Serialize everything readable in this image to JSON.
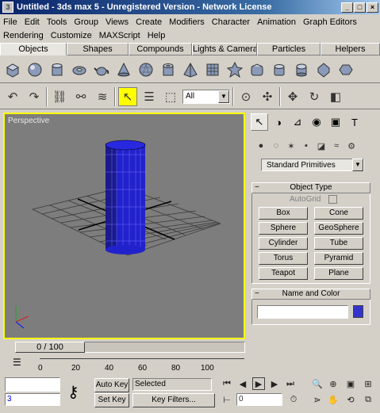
{
  "window": {
    "title": "Untitled - 3ds max 5 - Unregistered Version - Network License"
  },
  "menu": {
    "row1": [
      "File",
      "Edit",
      "Tools",
      "Group",
      "Views",
      "Create",
      "Modifiers",
      "Character",
      "Animation",
      "Graph Editors"
    ],
    "row2": [
      "Rendering",
      "Customize",
      "MAXScript",
      "Help"
    ]
  },
  "tabs": [
    "Objects",
    "Shapes",
    "Compounds",
    "Lights & Cameras",
    "Particles",
    "Helpers"
  ],
  "toolbar": {
    "selection_filter": "All"
  },
  "viewport": {
    "label": "Perspective"
  },
  "command_panel": {
    "dropdown": "Standard Primitives",
    "object_type": {
      "title": "Object Type",
      "autogrid": "AutoGrid",
      "buttons": [
        "Box",
        "Cone",
        "Sphere",
        "GeoSphere",
        "Cylinder",
        "Tube",
        "Torus",
        "Pyramid",
        "Teapot",
        "Plane"
      ]
    },
    "name_color": {
      "title": "Name and Color",
      "color": "#3333cc"
    }
  },
  "timeline": {
    "slider_label": "0 / 100",
    "ticks": [
      "0",
      "20",
      "40",
      "60",
      "80",
      "100"
    ]
  },
  "bottom": {
    "auto_key": "Auto Key",
    "set_key": "Set Key",
    "selected": "Selected",
    "key_filters": "Key Filters...",
    "frame_value": "0",
    "script_field": "3"
  },
  "colors": {
    "viewport_bg": "#7d7d7d",
    "active_border": "#ffff00",
    "object": "#2222cc"
  }
}
